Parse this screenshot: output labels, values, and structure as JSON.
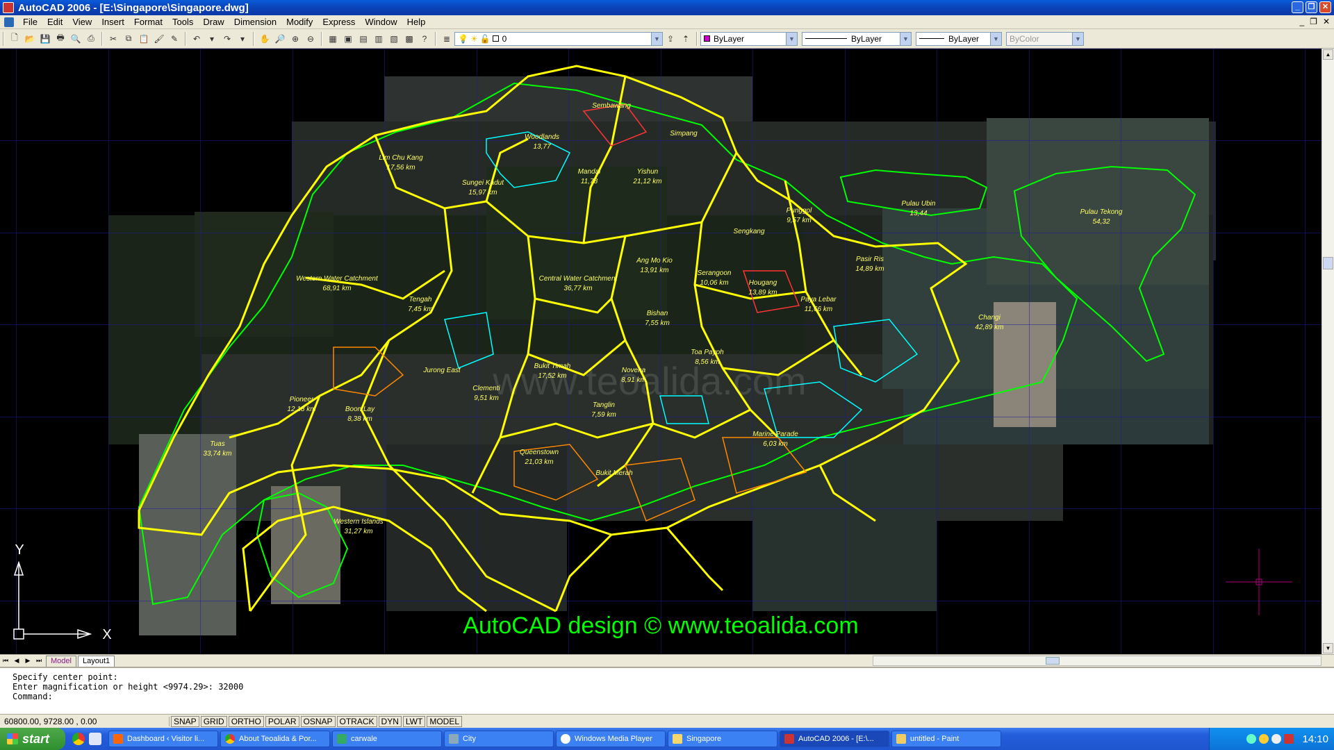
{
  "window": {
    "title": "AutoCAD 2006 - [E:\\Singapore\\Singapore.dwg]"
  },
  "menu": [
    "File",
    "Edit",
    "View",
    "Insert",
    "Format",
    "Tools",
    "Draw",
    "Dimension",
    "Modify",
    "Express",
    "Window",
    "Help"
  ],
  "toolbar": {
    "layer_value": "0",
    "color_value": "ByLayer",
    "linetype_value": "ByLayer",
    "lineweight_value": "ByLayer",
    "plotstyle_value": "ByColor",
    "color_swatch": "#cc00cc"
  },
  "map": {
    "districts": [
      {
        "name": "Lim Chu Kang",
        "area": "17,56 km"
      },
      {
        "name": "Sembawang",
        "area": ""
      },
      {
        "name": "Woodlands",
        "area": "13,77"
      },
      {
        "name": "Mandai",
        "area": "11,78"
      },
      {
        "name": "Yishun",
        "area": "21,12 km"
      },
      {
        "name": "Simpang",
        "area": ""
      },
      {
        "name": "Sungei Kadut",
        "area": "15,97 km"
      },
      {
        "name": "Punggol",
        "area": "9,57 km"
      },
      {
        "name": "Pulau Ubin",
        "area": "13,44"
      },
      {
        "name": "Pulau Tekong",
        "area": "54,32"
      },
      {
        "name": "Sengkang",
        "area": ""
      },
      {
        "name": "Western Water Catchment",
        "area": "68,91 km"
      },
      {
        "name": "Central Water Catchment",
        "area": "36,77 km"
      },
      {
        "name": "Ang Mo Kio",
        "area": "13,91 km"
      },
      {
        "name": "Serangoon",
        "area": "10,06 km"
      },
      {
        "name": "Hougang",
        "area": "13,89 km"
      },
      {
        "name": "Pasir Ris",
        "area": "14,89 km"
      },
      {
        "name": "Tengah",
        "area": "7,45 km"
      },
      {
        "name": "Paya Lebar",
        "area": "11,66 km"
      },
      {
        "name": "Bishan",
        "area": "7,55 km"
      },
      {
        "name": "Changi",
        "area": "42,89 km"
      },
      {
        "name": "Bukit Timah",
        "area": "17,52 km"
      },
      {
        "name": "Novena",
        "area": "8,91 km"
      },
      {
        "name": "Toa Payoh",
        "area": "8,56 km"
      },
      {
        "name": "Jurong East",
        "area": ""
      },
      {
        "name": "Clementi",
        "area": "9,51 km"
      },
      {
        "name": "Pioneer",
        "area": "12,18 km"
      },
      {
        "name": "Boon Lay",
        "area": "8,38 km"
      },
      {
        "name": "Tanglin",
        "area": "7,59 km"
      },
      {
        "name": "Tuas",
        "area": "33,74 km"
      },
      {
        "name": "Queenstown",
        "area": "21,03 km"
      },
      {
        "name": "Bukit Merah",
        "area": ""
      },
      {
        "name": "Marine Parade",
        "area": "6,03 km"
      },
      {
        "name": "Western Islands",
        "area": "31,27 km"
      }
    ],
    "watermark": "AutoCAD design  ©  www.teoalida.com",
    "watermark_center": "www.teoalida.com",
    "ucs_y": "Y",
    "ucs_x": "X"
  },
  "layout_tabs": [
    "Model",
    "Layout1"
  ],
  "command_lines": [
    "Specify center point:",
    "Enter magnification or height <9974.29>: 32000",
    "Command:"
  ],
  "status": {
    "coords": "60800.00, 9728.00 , 0.00",
    "toggles": [
      "SNAP",
      "GRID",
      "ORTHO",
      "POLAR",
      "OSNAP",
      "OTRACK",
      "DYN",
      "LWT",
      "MODEL"
    ]
  },
  "taskbar": {
    "start_label": "start",
    "tasks": [
      "Dashboard ‹ Visitor li...",
      "About Teoalida & Por...",
      "carwale",
      "City",
      "Windows Media Player",
      "Singapore",
      "AutoCAD 2006 - [E:\\...",
      "untitled - Paint"
    ],
    "clock": "14:10"
  },
  "colors": {
    "boundary": "#ffff00",
    "coastline": "#00ff00",
    "grid": "#1a1aa0"
  }
}
